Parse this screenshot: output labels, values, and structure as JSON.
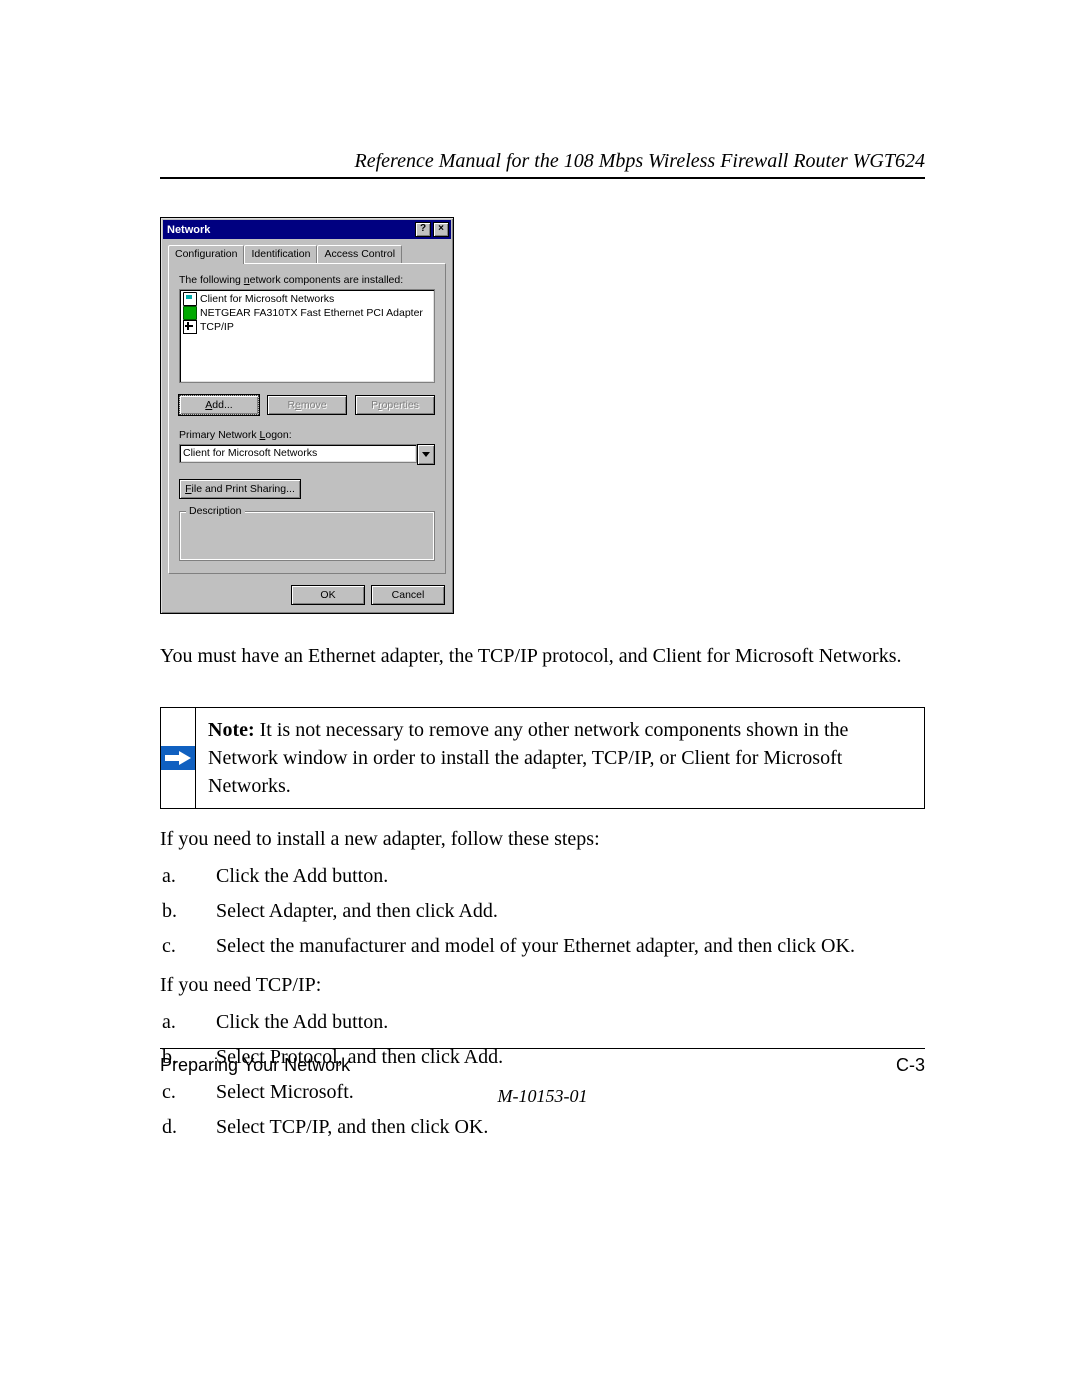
{
  "header": {
    "title": "Reference Manual for the 108 Mbps Wireless Firewall Router WGT624"
  },
  "dialog": {
    "title": "Network",
    "help_btn": "?",
    "close_btn": "×",
    "tabs": {
      "t1": "Configuration",
      "t2": "Identification",
      "t3": "Access Control"
    },
    "installed_label": "The following network components are installed:",
    "list": {
      "i1": "Client for Microsoft Networks",
      "i2": "NETGEAR FA310TX Fast Ethernet PCI Adapter",
      "i3": "TCP/IP"
    },
    "btn_add": "Add...",
    "btn_remove": "Remove",
    "btn_props": "Properties",
    "primary_label": "Primary Network Logon:",
    "primary_value": "Client for Microsoft Networks",
    "btn_share": "File and Print Sharing...",
    "group_desc": "Description",
    "btn_ok": "OK",
    "btn_cancel": "Cancel"
  },
  "body": {
    "para1": "You must have an Ethernet adapter, the TCP/IP protocol, and Client for Microsoft Networks.",
    "note_label": "Note: ",
    "note_text": "It is not necessary to remove any other network components shown in the Network window in order to install the adapter, TCP/IP, or Client for Microsoft Networks.",
    "para2": "If you need to install a new adapter, follow these steps:",
    "adapter_steps": {
      "a": "Click the Add button.",
      "b": "Select Adapter, and then click Add.",
      "c": "Select the manufacturer and model of your Ethernet adapter, and then click OK."
    },
    "para3": "If you need TCP/IP:",
    "tcpip_steps": {
      "a": "Click the Add button.",
      "b": "Select Protocol, and then click Add.",
      "c": "Select Microsoft.",
      "d": "Select TCP/IP, and then click OK."
    }
  },
  "footer": {
    "section": "Preparing Your Network",
    "page": "C-3",
    "docnum": "M-10153-01"
  }
}
